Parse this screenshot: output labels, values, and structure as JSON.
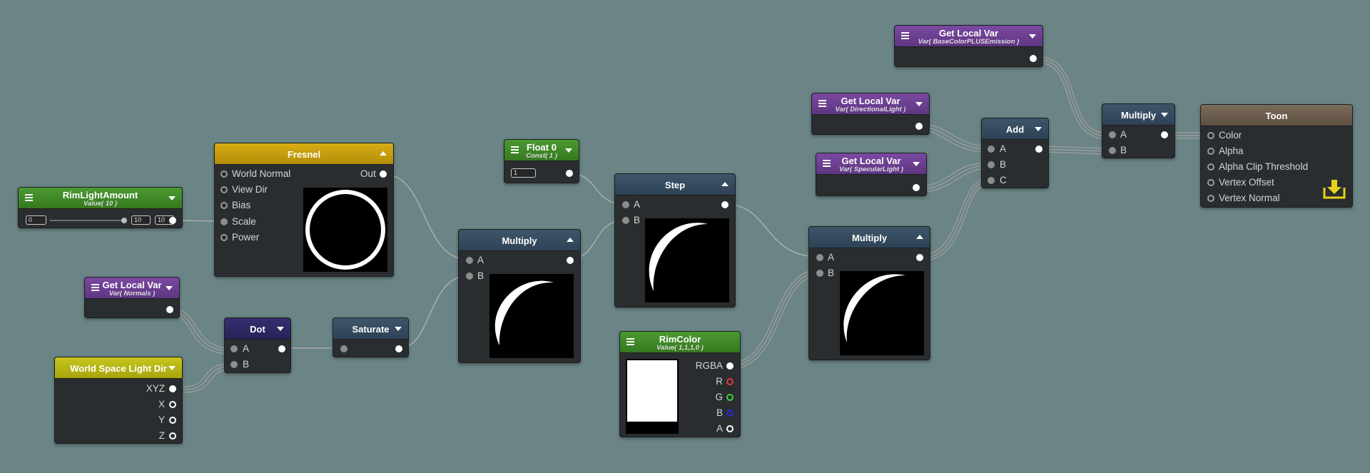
{
  "colors": {
    "canvas": "#6b8486",
    "node_body": "#2a2d2f",
    "header_slate": "#34495c",
    "header_yellow": "#c9a10f",
    "header_green": "#3d8a2a",
    "header_purple": "#6b3f8f",
    "header_indigo": "#2e2b6e",
    "header_lime": "#b6b414",
    "header_brown": "#6e5f4e",
    "master_icon": "#e6d21a"
  },
  "nodes": {
    "rim_light_amount": {
      "title": "RimLightAmount",
      "subtitle": "Value( 10 )",
      "min_value": "0",
      "max_value": "10",
      "current_value": "10",
      "slider_fraction": 1.0,
      "icon": "hamburger-menu-icon"
    },
    "fresnel": {
      "title": "Fresnel",
      "inputs": [
        "World Normal",
        "View Dir",
        "Bias",
        "Scale",
        "Power"
      ],
      "output": "Out"
    },
    "get_local_var_normals": {
      "title": "Get Local Var",
      "subtitle": "Var( Normals )"
    },
    "world_space_light_dir": {
      "title": "World Space Light Dir",
      "outputs": [
        "XYZ",
        "X",
        "Y",
        "Z"
      ]
    },
    "dot": {
      "title": "Dot",
      "inputs": [
        "A",
        "B"
      ]
    },
    "saturate": {
      "title": "Saturate"
    },
    "float0": {
      "title": "Float 0",
      "subtitle": "Const( 1 )",
      "value": "1"
    },
    "multiply_1": {
      "title": "Multiply",
      "inputs": [
        "A",
        "B"
      ]
    },
    "step": {
      "title": "Step",
      "inputs": [
        "A",
        "B"
      ]
    },
    "rim_color": {
      "title": "RimColor",
      "subtitle": "Value( 1,1,1,0 )",
      "outputs": [
        "RGBA",
        "R",
        "G",
        "B",
        "A"
      ],
      "swatch_color": "#ffffff"
    },
    "multiply_2": {
      "title": "Multiply",
      "inputs": [
        "A",
        "B"
      ]
    },
    "get_local_var_directional": {
      "title": "Get Local Var",
      "subtitle": "Var( DirectionalLight )"
    },
    "get_local_var_specular": {
      "title": "Get Local Var",
      "subtitle": "Var( SpecularLight )"
    },
    "get_local_var_basecolor": {
      "title": "Get Local Var",
      "subtitle": "Var( BaseColorPLUSEmission )"
    },
    "add": {
      "title": "Add",
      "inputs": [
        "A",
        "B",
        "C"
      ]
    },
    "multiply_3": {
      "title": "Multiply",
      "inputs": [
        "A",
        "B"
      ]
    },
    "toon": {
      "title": "Toon",
      "inputs": [
        "Color",
        "Alpha",
        "Alpha Clip Threshold",
        "Vertex Offset",
        "Vertex Normal"
      ],
      "icon": "master-node-download-icon"
    }
  }
}
